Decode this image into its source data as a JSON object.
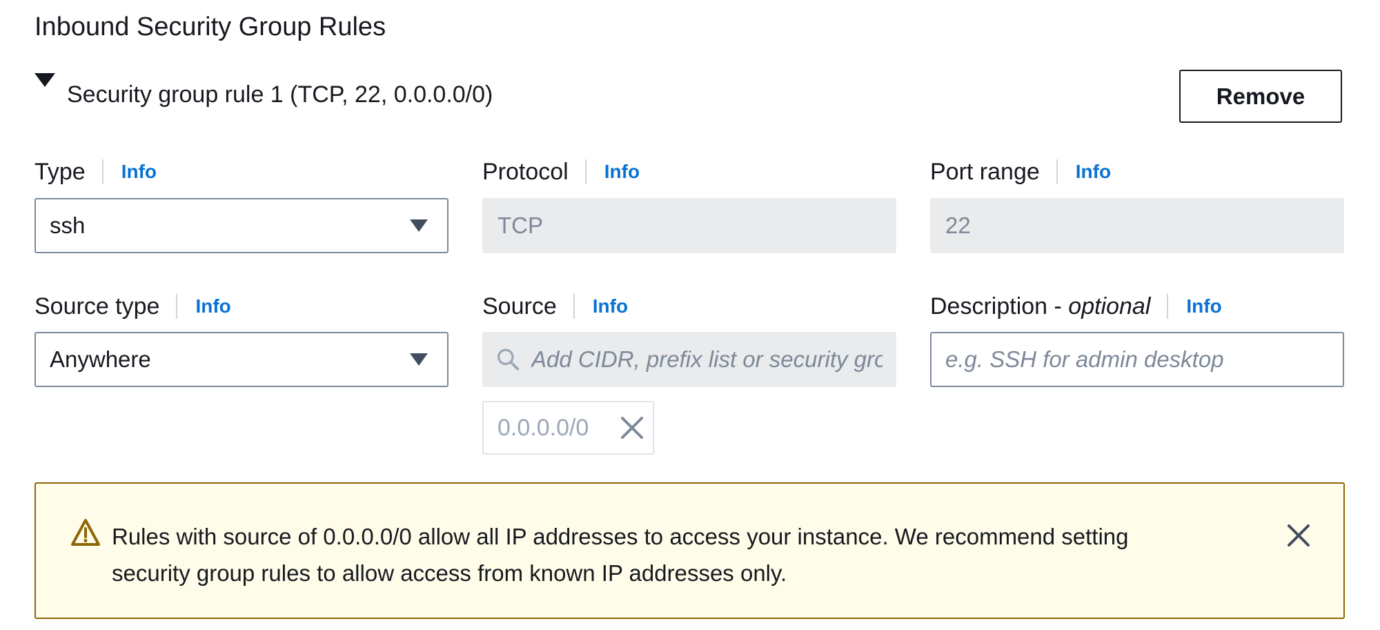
{
  "section_title": "Inbound Security Group Rules",
  "rule": {
    "title": "Security group rule 1 (TCP, 22, 0.0.0.0/0)",
    "remove_label": "Remove"
  },
  "info_label": "Info",
  "fields": {
    "type": {
      "label": "Type",
      "value": "ssh"
    },
    "protocol": {
      "label": "Protocol",
      "value": "TCP"
    },
    "port_range": {
      "label": "Port range",
      "value": "22"
    },
    "source_type": {
      "label": "Source type",
      "value": "Anywhere"
    },
    "source": {
      "label": "Source",
      "placeholder": "Add CIDR, prefix list or security group",
      "tokens": [
        "0.0.0.0/0"
      ]
    },
    "description": {
      "label": "Description - ",
      "label_optional": "optional",
      "placeholder": "e.g. SSH for admin desktop"
    }
  },
  "alert": {
    "line1": "Rules with source of 0.0.0.0/0 allow all IP addresses to access your instance. We recommend setting",
    "line2": "security group rules to allow access from known IP addresses only."
  },
  "icons": {
    "expand": "caret-down-icon",
    "select": "dropdown-triangle-icon",
    "search": "search-icon",
    "remove_token": "close-icon",
    "warning": "warning-icon",
    "dismiss": "close-icon"
  },
  "colors": {
    "link": "#0972d3",
    "warning_border": "#8d6605",
    "warning_bg": "#fffce9",
    "disabled_bg": "#e9ebed"
  }
}
